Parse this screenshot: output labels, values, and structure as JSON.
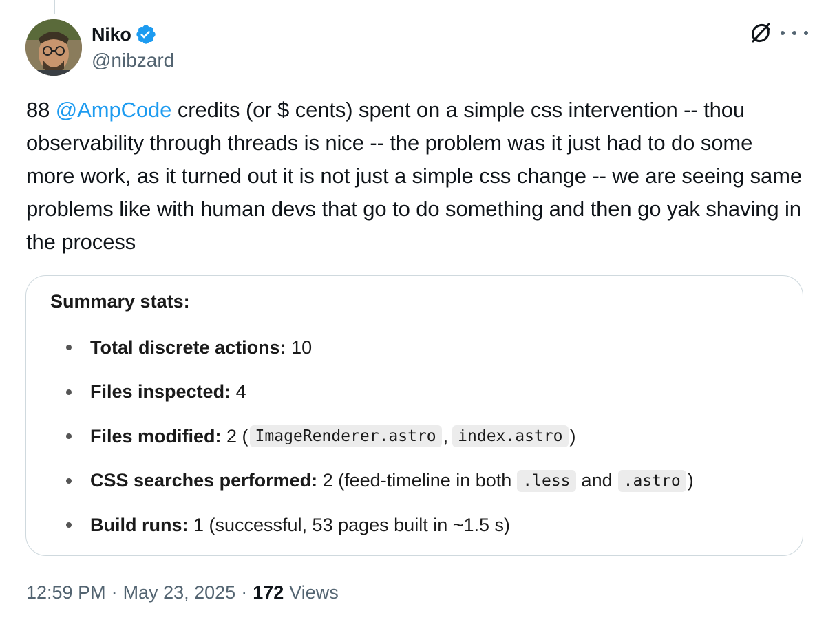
{
  "author": {
    "name": "Niko",
    "handle": "@nibzard"
  },
  "tweet": {
    "text_prefix": "88 ",
    "mention": "@AmpCode",
    "text_suffix": " credits (or $ cents) spent on a simple css intervention -- thou observability through threads is nice -- the problem was it just had to do some more work, as it turned out it is not just a simple css change -- we are seeing same problems like with human devs that go to do something and then go yak shaving in the process"
  },
  "card": {
    "title": "Summary stats:",
    "stats": [
      {
        "label": "Total discrete actions:",
        "value": " 10"
      },
      {
        "label": "Files inspected:",
        "value": " 4"
      },
      {
        "label": "Files modified:",
        "value_prefix": " 2 (",
        "code1": "ImageRenderer.astro",
        "mid": ",",
        "code2": "index.astro",
        "value_suffix": ")"
      },
      {
        "label": "CSS searches performed:",
        "value_prefix": " 2 (feed-timeline in both",
        "code1": ".less",
        "mid": "and",
        "code2": ".astro",
        "value_suffix": ")"
      },
      {
        "label": "Build runs:",
        "value": " 1 (successful, 53 pages built in ~1.5 s)"
      }
    ]
  },
  "meta": {
    "time": "12:59 PM",
    "date": "May 23, 2025",
    "separator": "·",
    "views_count": "172",
    "views_label": "Views"
  },
  "colors": {
    "accent": "#1d9bf0",
    "secondary_text": "#536471",
    "primary_text": "#0f1419",
    "border": "#cfd9de"
  },
  "icons": {
    "verified": "verified-badge-icon",
    "grok": "grok-icon",
    "more": "more-icon"
  }
}
